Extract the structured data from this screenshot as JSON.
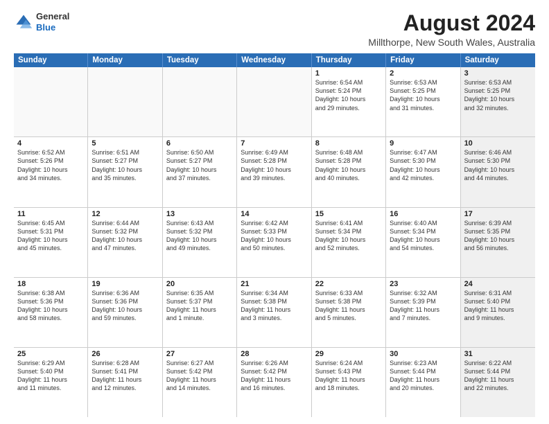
{
  "logo": {
    "general": "General",
    "blue": "Blue"
  },
  "title": {
    "month_year": "August 2024",
    "location": "Millthorpe, New South Wales, Australia"
  },
  "calendar": {
    "headers": [
      "Sunday",
      "Monday",
      "Tuesday",
      "Wednesday",
      "Thursday",
      "Friday",
      "Saturday"
    ],
    "rows": [
      [
        {
          "day": "",
          "text": "",
          "empty": true
        },
        {
          "day": "",
          "text": "",
          "empty": true
        },
        {
          "day": "",
          "text": "",
          "empty": true
        },
        {
          "day": "",
          "text": "",
          "empty": true
        },
        {
          "day": "1",
          "text": "Sunrise: 6:54 AM\nSunset: 5:24 PM\nDaylight: 10 hours\nand 29 minutes.",
          "empty": false
        },
        {
          "day": "2",
          "text": "Sunrise: 6:53 AM\nSunset: 5:25 PM\nDaylight: 10 hours\nand 31 minutes.",
          "empty": false
        },
        {
          "day": "3",
          "text": "Sunrise: 6:53 AM\nSunset: 5:25 PM\nDaylight: 10 hours\nand 32 minutes.",
          "empty": false,
          "shaded": true
        }
      ],
      [
        {
          "day": "4",
          "text": "Sunrise: 6:52 AM\nSunset: 5:26 PM\nDaylight: 10 hours\nand 34 minutes.",
          "empty": false
        },
        {
          "day": "5",
          "text": "Sunrise: 6:51 AM\nSunset: 5:27 PM\nDaylight: 10 hours\nand 35 minutes.",
          "empty": false
        },
        {
          "day": "6",
          "text": "Sunrise: 6:50 AM\nSunset: 5:27 PM\nDaylight: 10 hours\nand 37 minutes.",
          "empty": false
        },
        {
          "day": "7",
          "text": "Sunrise: 6:49 AM\nSunset: 5:28 PM\nDaylight: 10 hours\nand 39 minutes.",
          "empty": false
        },
        {
          "day": "8",
          "text": "Sunrise: 6:48 AM\nSunset: 5:28 PM\nDaylight: 10 hours\nand 40 minutes.",
          "empty": false
        },
        {
          "day": "9",
          "text": "Sunrise: 6:47 AM\nSunset: 5:30 PM\nDaylight: 10 hours\nand 42 minutes.",
          "empty": false
        },
        {
          "day": "10",
          "text": "Sunrise: 6:46 AM\nSunset: 5:30 PM\nDaylight: 10 hours\nand 44 minutes.",
          "empty": false,
          "shaded": true
        }
      ],
      [
        {
          "day": "11",
          "text": "Sunrise: 6:45 AM\nSunset: 5:31 PM\nDaylight: 10 hours\nand 45 minutes.",
          "empty": false
        },
        {
          "day": "12",
          "text": "Sunrise: 6:44 AM\nSunset: 5:32 PM\nDaylight: 10 hours\nand 47 minutes.",
          "empty": false
        },
        {
          "day": "13",
          "text": "Sunrise: 6:43 AM\nSunset: 5:32 PM\nDaylight: 10 hours\nand 49 minutes.",
          "empty": false
        },
        {
          "day": "14",
          "text": "Sunrise: 6:42 AM\nSunset: 5:33 PM\nDaylight: 10 hours\nand 50 minutes.",
          "empty": false
        },
        {
          "day": "15",
          "text": "Sunrise: 6:41 AM\nSunset: 5:34 PM\nDaylight: 10 hours\nand 52 minutes.",
          "empty": false
        },
        {
          "day": "16",
          "text": "Sunrise: 6:40 AM\nSunset: 5:34 PM\nDaylight: 10 hours\nand 54 minutes.",
          "empty": false
        },
        {
          "day": "17",
          "text": "Sunrise: 6:39 AM\nSunset: 5:35 PM\nDaylight: 10 hours\nand 56 minutes.",
          "empty": false,
          "shaded": true
        }
      ],
      [
        {
          "day": "18",
          "text": "Sunrise: 6:38 AM\nSunset: 5:36 PM\nDaylight: 10 hours\nand 58 minutes.",
          "empty": false
        },
        {
          "day": "19",
          "text": "Sunrise: 6:36 AM\nSunset: 5:36 PM\nDaylight: 10 hours\nand 59 minutes.",
          "empty": false
        },
        {
          "day": "20",
          "text": "Sunrise: 6:35 AM\nSunset: 5:37 PM\nDaylight: 11 hours\nand 1 minute.",
          "empty": false
        },
        {
          "day": "21",
          "text": "Sunrise: 6:34 AM\nSunset: 5:38 PM\nDaylight: 11 hours\nand 3 minutes.",
          "empty": false
        },
        {
          "day": "22",
          "text": "Sunrise: 6:33 AM\nSunset: 5:38 PM\nDaylight: 11 hours\nand 5 minutes.",
          "empty": false
        },
        {
          "day": "23",
          "text": "Sunrise: 6:32 AM\nSunset: 5:39 PM\nDaylight: 11 hours\nand 7 minutes.",
          "empty": false
        },
        {
          "day": "24",
          "text": "Sunrise: 6:31 AM\nSunset: 5:40 PM\nDaylight: 11 hours\nand 9 minutes.",
          "empty": false,
          "shaded": true
        }
      ],
      [
        {
          "day": "25",
          "text": "Sunrise: 6:29 AM\nSunset: 5:40 PM\nDaylight: 11 hours\nand 11 minutes.",
          "empty": false
        },
        {
          "day": "26",
          "text": "Sunrise: 6:28 AM\nSunset: 5:41 PM\nDaylight: 11 hours\nand 12 minutes.",
          "empty": false
        },
        {
          "day": "27",
          "text": "Sunrise: 6:27 AM\nSunset: 5:42 PM\nDaylight: 11 hours\nand 14 minutes.",
          "empty": false
        },
        {
          "day": "28",
          "text": "Sunrise: 6:26 AM\nSunset: 5:42 PM\nDaylight: 11 hours\nand 16 minutes.",
          "empty": false
        },
        {
          "day": "29",
          "text": "Sunrise: 6:24 AM\nSunset: 5:43 PM\nDaylight: 11 hours\nand 18 minutes.",
          "empty": false
        },
        {
          "day": "30",
          "text": "Sunrise: 6:23 AM\nSunset: 5:44 PM\nDaylight: 11 hours\nand 20 minutes.",
          "empty": false
        },
        {
          "day": "31",
          "text": "Sunrise: 6:22 AM\nSunset: 5:44 PM\nDaylight: 11 hours\nand 22 minutes.",
          "empty": false,
          "shaded": true
        }
      ]
    ]
  }
}
